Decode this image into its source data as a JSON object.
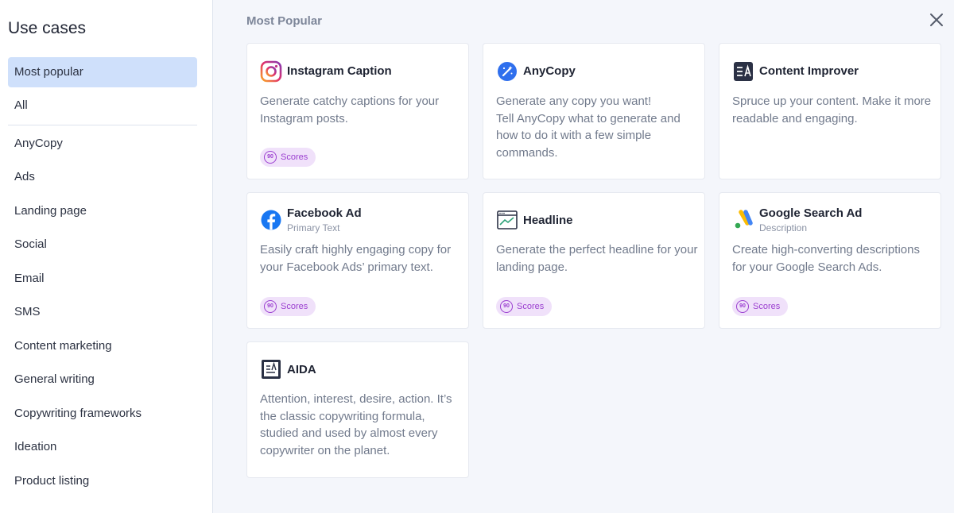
{
  "sidebar": {
    "title": "Use cases",
    "items": [
      {
        "label": "Most popular",
        "active": true
      },
      {
        "label": "All"
      },
      {
        "label": "AnyCopy"
      },
      {
        "label": "Ads"
      },
      {
        "label": "Landing page"
      },
      {
        "label": "Social"
      },
      {
        "label": "Email"
      },
      {
        "label": "SMS"
      },
      {
        "label": "Content marketing"
      },
      {
        "label": "General writing"
      },
      {
        "label": "Copywriting frameworks"
      },
      {
        "label": "Ideation"
      },
      {
        "label": "Product listing"
      }
    ]
  },
  "main": {
    "section_title": "Most Popular",
    "close_icon": "close-icon",
    "cards": [
      {
        "title": "Instagram Caption",
        "subtitle": "",
        "icon": "instagram-icon",
        "description": "Generate catchy captions for your Instagram posts.",
        "badge": {
          "value": "90",
          "label": "Scores"
        }
      },
      {
        "title": "AnyCopy",
        "subtitle": "",
        "icon": "magic-wand-icon",
        "description": "Generate any copy you want!\nTell AnyCopy what to generate and how to do it with a few simple commands."
      },
      {
        "title": "Content Improver",
        "subtitle": "",
        "icon": "text-improve-icon",
        "description": "Spruce up your content. Make it more readable and engaging."
      },
      {
        "title": "Facebook Ad",
        "subtitle": "Primary Text",
        "icon": "facebook-icon",
        "description": "Easily craft highly engaging copy for your Facebook Ads’ primary text.",
        "badge": {
          "value": "90",
          "label": "Scores"
        }
      },
      {
        "title": "Headline",
        "subtitle": "",
        "icon": "headline-icon",
        "description": "Generate the perfect headline for your landing page.",
        "badge": {
          "value": "90",
          "label": "Scores"
        }
      },
      {
        "title": "Google Search Ad",
        "subtitle": "Description",
        "icon": "google-ads-icon",
        "description": "Create high-converting descriptions for your Google Search Ads.",
        "badge": {
          "value": "90",
          "label": "Scores"
        }
      },
      {
        "title": "AIDA",
        "subtitle": "",
        "icon": "aida-icon",
        "description": "Attention, interest, desire, action. It’s the classic copywriting formula, studied and used by almost every copywriter on the planet."
      }
    ]
  },
  "colors": {
    "active_nav_bg": "#cfe0fb",
    "badge_bg": "#f0e1fa",
    "badge_fg": "#9b3fd0",
    "page_bg": "#f4f6fb"
  }
}
